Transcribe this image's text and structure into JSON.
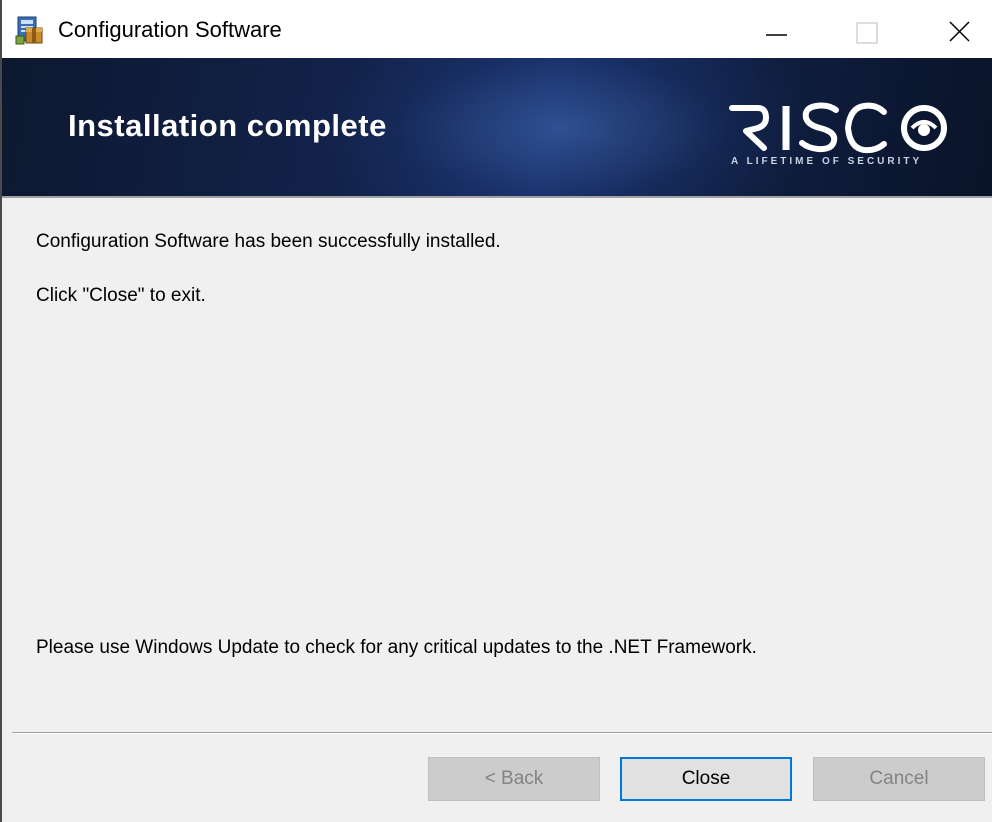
{
  "window": {
    "title": "Configuration Software",
    "controls": [
      "minimize-icon",
      "maximize-icon",
      "close-icon"
    ]
  },
  "banner": {
    "heading": "Installation complete",
    "logo_text": "RISCO",
    "logo_tagline": "A LIFETIME OF SECURITY"
  },
  "body": {
    "line1": "Configuration Software has been successfully installed.",
    "line2": "Click \"Close\" to exit.",
    "line3": "Please use Windows Update to check for any critical updates to the .NET Framework."
  },
  "buttons": {
    "back": "< Back",
    "close": "Close",
    "cancel": "Cancel"
  },
  "colors": {
    "accent": "#0078d7",
    "banner_dark": "#0d1830",
    "dialog_bg": "#f0f0f0"
  }
}
